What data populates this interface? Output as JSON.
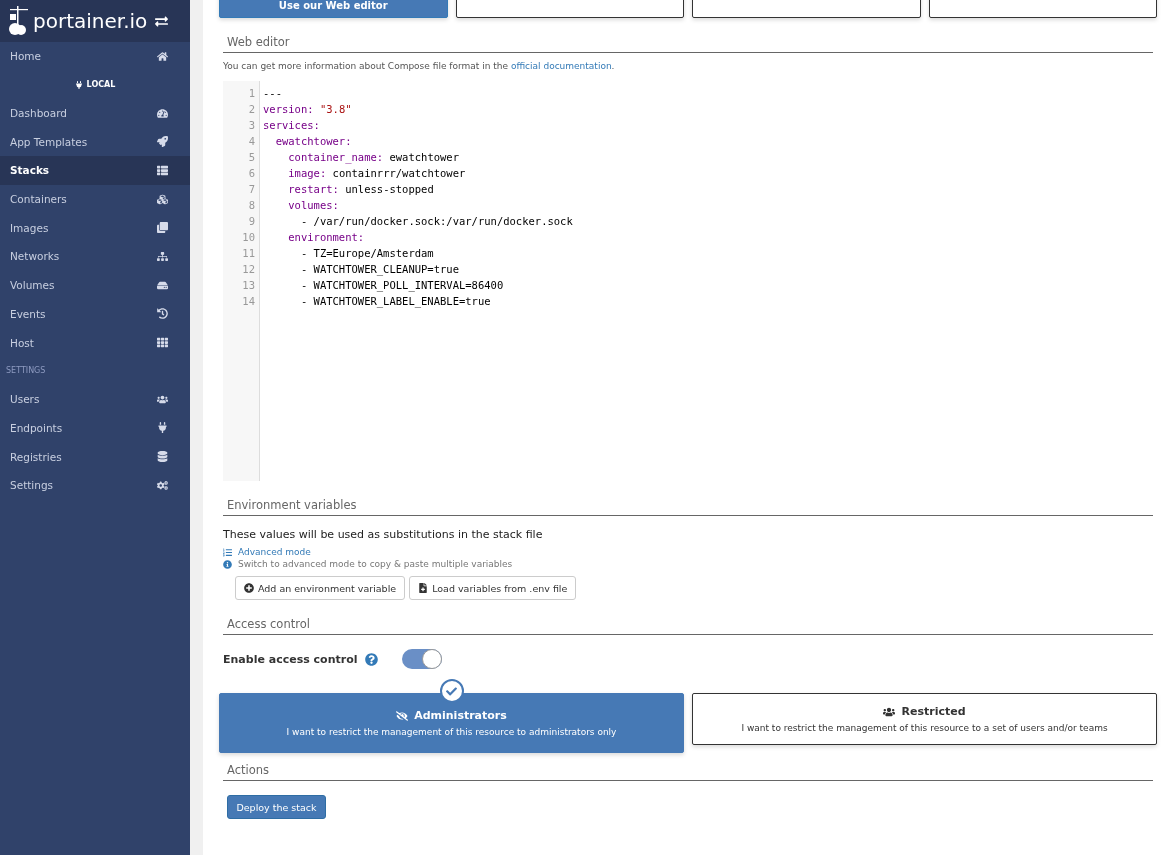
{
  "sidebar": {
    "logo": "portainer.io",
    "items": [
      {
        "label": "Home",
        "selected": false,
        "kind": "item"
      },
      {
        "label": "LOCAL",
        "kind": "endpoint"
      },
      {
        "label": "Dashboard",
        "selected": false,
        "kind": "item"
      },
      {
        "label": "App Templates",
        "selected": false,
        "kind": "item"
      },
      {
        "label": "Stacks",
        "selected": true,
        "kind": "item"
      },
      {
        "label": "Containers",
        "selected": false,
        "kind": "item"
      },
      {
        "label": "Images",
        "selected": false,
        "kind": "item"
      },
      {
        "label": "Networks",
        "selected": false,
        "kind": "item"
      },
      {
        "label": "Volumes",
        "selected": false,
        "kind": "item"
      },
      {
        "label": "Events",
        "selected": false,
        "kind": "item"
      },
      {
        "label": "Host",
        "selected": false,
        "kind": "item"
      },
      {
        "label": "SETTINGS",
        "kind": "heading"
      },
      {
        "label": "Users",
        "selected": false,
        "kind": "item"
      },
      {
        "label": "Endpoints",
        "selected": false,
        "kind": "item"
      },
      {
        "label": "Registries",
        "selected": false,
        "kind": "item"
      },
      {
        "label": "Settings",
        "selected": false,
        "kind": "item"
      }
    ]
  },
  "build_methods": [
    {
      "label": "Use our Web editor",
      "selected": true
    },
    {
      "selected": false
    },
    {
      "selected": false
    },
    {
      "selected": false
    }
  ],
  "web_editor": {
    "title": "Web editor",
    "note": "You can get more information about Compose file format in the",
    "link": "official documentation",
    "note_end": ".",
    "lines": [
      {
        "number": "1",
        "text": "---"
      },
      {
        "number": "2",
        "text": "version: \"3.8\""
      },
      {
        "number": "3",
        "text": "services:"
      },
      {
        "number": "4",
        "text": "  ewatchtower:"
      },
      {
        "number": "5",
        "text": "    container_name: ewatchtower"
      },
      {
        "number": "6",
        "text": "    image: containrrr/watchtower"
      },
      {
        "number": "7",
        "text": "    restart: unless-stopped"
      },
      {
        "number": "8",
        "text": "    volumes:"
      },
      {
        "number": "9",
        "text": "      - /var/run/docker.sock:/var/run/docker.sock"
      },
      {
        "number": "10",
        "text": "    environment:"
      },
      {
        "number": "11",
        "text": "      - TZ=Europe/Amsterdam"
      },
      {
        "number": "12",
        "text": "      - WATCHTOWER_CLEANUP=true"
      },
      {
        "number": "13",
        "text": "      - WATCHTOWER_POLL_INTERVAL=86400"
      },
      {
        "number": "14",
        "text": "      - WATCHTOWER_LABEL_ENABLE=true"
      }
    ]
  },
  "environment": {
    "title": "Environment variables",
    "description": "These values will be used as substitutions in the stack file",
    "advanced_link": "Advanced mode",
    "hint": "Switch to advanced mode to copy & paste multiple variables",
    "buttons": [
      {
        "label": "Add an environment variable"
      },
      {
        "label": "Load variables from .env file"
      }
    ]
  },
  "access_control": {
    "title": "Access control",
    "toggle_label": "Enable access control",
    "toggle_on": true,
    "options": [
      {
        "title": "Administrators",
        "description": "I want to restrict the management of this resource to administrators only",
        "selected": true
      },
      {
        "title": "Restricted",
        "description": "I want to restrict the management of this resource to a set of users and/or teams",
        "selected": false
      }
    ]
  },
  "actions": {
    "title": "Actions",
    "button": "Deploy the stack"
  }
}
